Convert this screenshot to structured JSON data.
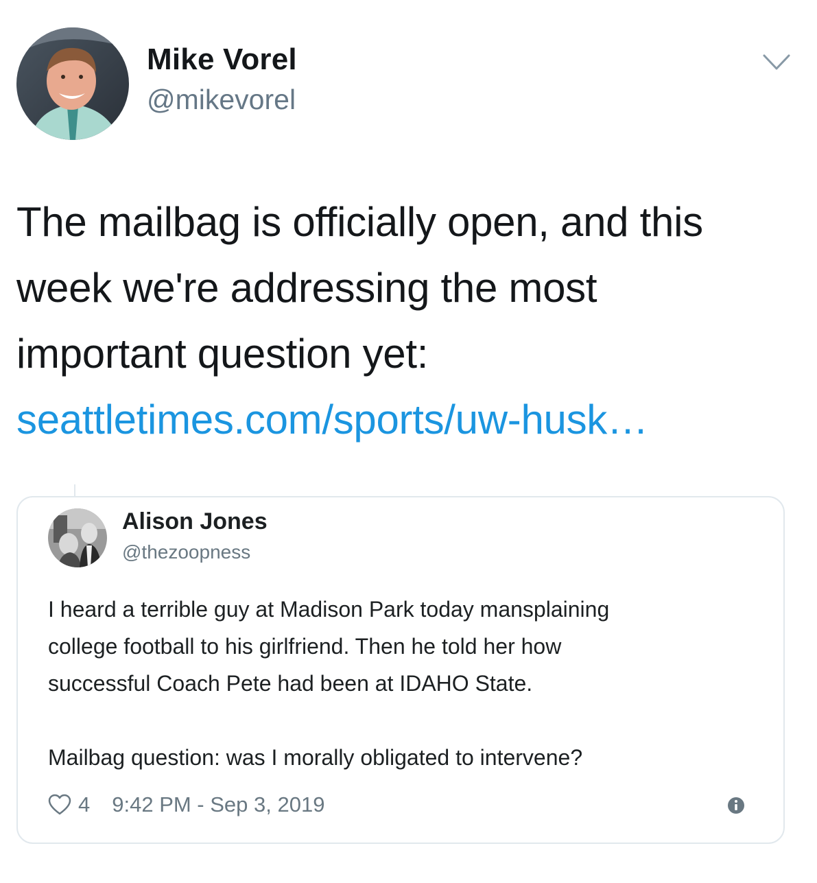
{
  "tweet": {
    "author": {
      "name": "Mike Vorel",
      "handle": "@mikevorel",
      "avatar": "profile-photo"
    },
    "menu_icon": "chevron-down-icon",
    "text_lines": [
      "The mailbag is officially open, and this",
      "week we're addressing the most",
      "important question yet:"
    ],
    "link": "seattletimes.com/sports/uw-husk…",
    "colors": {
      "link": "#1b95e0",
      "text": "#14171a",
      "secondary": "#657786",
      "border": "#e1e8ed"
    }
  },
  "quoted_tweet": {
    "author": {
      "name": "Alison Jones",
      "handle": "@thezoopness",
      "avatar": "profile-photo"
    },
    "body_lines": [
      "I heard a terrible guy at Madison Park today mansplaining",
      "college football to his girlfriend. Then he told her how",
      "successful Coach Pete had been at IDAHO State."
    ],
    "question_line": "Mailbag question: was I morally obligated to intervene?",
    "likes": "4",
    "timestamp": "9:42 PM - Sep 3, 2019",
    "like_icon": "heart-icon",
    "info_icon": "info-icon"
  }
}
